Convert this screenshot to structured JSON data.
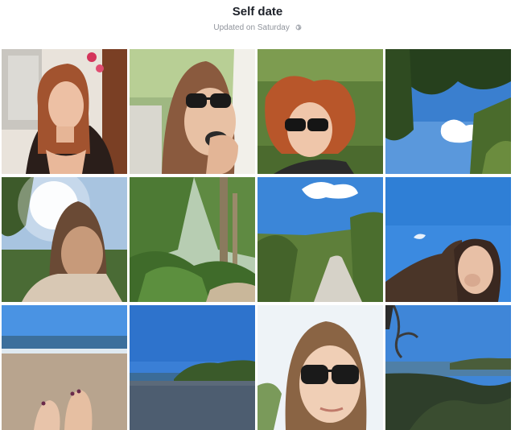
{
  "album": {
    "title": "Self date",
    "updated": "Updated on Saturday",
    "privacy_icon": "globe-icon"
  },
  "photos": [
    {
      "name": "photo-selfie-window"
    },
    {
      "name": "photo-selfie-sunglasses-eating"
    },
    {
      "name": "photo-selfie-lying-grass"
    },
    {
      "name": "photo-trees-sky"
    },
    {
      "name": "photo-sun-flare-selfie"
    },
    {
      "name": "photo-forest-trees"
    },
    {
      "name": "photo-sandy-path"
    },
    {
      "name": "photo-selfie-blue-sky"
    },
    {
      "name": "photo-beach-feet"
    },
    {
      "name": "photo-beach-headland"
    },
    {
      "name": "photo-selfie-sunglasses-smile"
    },
    {
      "name": "photo-beach-branches"
    }
  ]
}
